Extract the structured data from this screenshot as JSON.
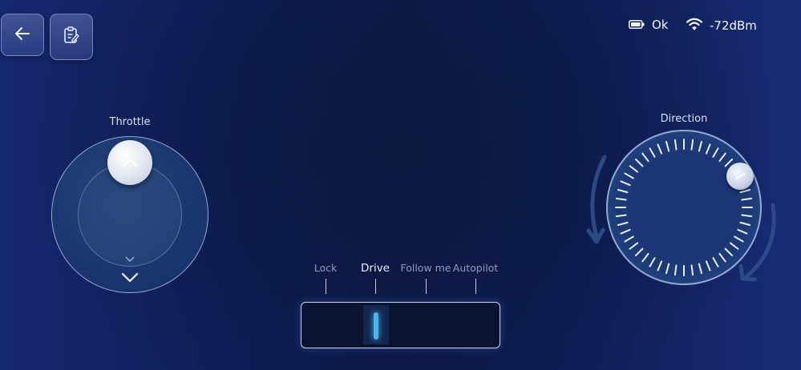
{
  "toolbar": {
    "back_icon": "arrow-left-icon",
    "notes_icon": "clipboard-edit-icon"
  },
  "status": {
    "battery_icon": "battery-icon",
    "battery_text": "Ok",
    "wifi_icon": "wifi-icon",
    "signal_text": "-72dBm"
  },
  "throttle": {
    "label": "Throttle",
    "up_icon": "chevron-up-icon",
    "down_icon": "chevron-down-icon"
  },
  "direction": {
    "label": "Direction",
    "rotate_left_icon": "rotate-left-arrow-icon",
    "rotate_right_icon": "rotate-right-arrow-icon"
  },
  "mode": {
    "options": [
      "Lock",
      "Drive",
      "Follow me",
      "Autopilot"
    ],
    "selected": "Drive",
    "lock_label": "Lock",
    "drive_label": "Drive",
    "follow_label": "Follow me",
    "autopilot_label": "Autopilot"
  },
  "colors": {
    "accent": "#49b6ee",
    "background": "#0f1e58"
  }
}
